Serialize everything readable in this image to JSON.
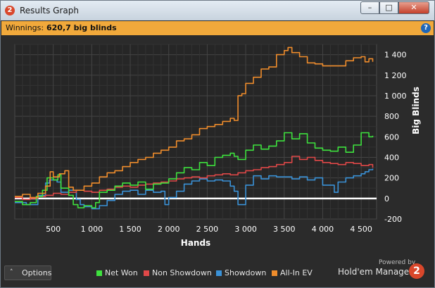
{
  "window": {
    "title": "Results Graph",
    "app_icon_text": "2",
    "buttons": {
      "minimize": "–",
      "maximize": "□",
      "close": "✕"
    }
  },
  "winnings": {
    "label": "Winnings:",
    "value": "620,7 big blinds",
    "help_icon": "?"
  },
  "options": {
    "chevron_icon": "˄",
    "label": "Options"
  },
  "branding": {
    "powered_by": "Powered by",
    "name": "Hold'em Manager",
    "logo_text": "2"
  },
  "colors": {
    "net_won": "#3ee23e",
    "non_showdown": "#e04848",
    "showdown": "#3a92d8",
    "all_in_ev": "#f08d2c",
    "zero_line": "#ffffff",
    "plot_bg": "#262626",
    "grid": "#3d3d3d",
    "winnings_bar": "#f1a93b"
  },
  "chart_data": {
    "type": "line",
    "xlabel": "Hands",
    "ylabel": "Big Blinds",
    "xlim": [
      0,
      4700
    ],
    "ylim": [
      -200,
      1500
    ],
    "xticks": [
      500,
      1000,
      1500,
      2000,
      2500,
      3000,
      3500,
      4000,
      4500
    ],
    "xtick_labels": [
      "500",
      "1 000",
      "1 500",
      "2 000",
      "2 500",
      "3 000",
      "3 500",
      "4 000",
      "4 500"
    ],
    "yticks": [
      -200,
      0,
      200,
      400,
      600,
      800,
      1000,
      1200,
      1400
    ],
    "ytick_labels": [
      "-200",
      "0",
      "200",
      "400",
      "600",
      "800",
      "1 000",
      "1 200",
      "1 400"
    ],
    "grid": true,
    "legend_position": "bottom",
    "series": [
      {
        "name": "Net Won",
        "x": [
          0,
          100,
          200,
          280,
          360,
          420,
          500,
          560,
          600,
          700,
          760,
          820,
          900,
          1000,
          1050,
          1100,
          1200,
          1300,
          1400,
          1500,
          1600,
          1700,
          1800,
          1900,
          2000,
          2100,
          2200,
          2300,
          2400,
          2500,
          2600,
          2700,
          2800,
          2850,
          2900,
          3000,
          3100,
          3200,
          3300,
          3400,
          3500,
          3600,
          3700,
          3800,
          3900,
          4000,
          4100,
          4200,
          4300,
          4400,
          4500,
          4600,
          4650
        ],
        "y": [
          -30,
          -60,
          -40,
          20,
          80,
          200,
          180,
          230,
          100,
          30,
          -60,
          -90,
          -70,
          -90,
          -40,
          60,
          80,
          120,
          150,
          130,
          160,
          90,
          140,
          150,
          190,
          250,
          300,
          280,
          350,
          320,
          400,
          420,
          440,
          410,
          380,
          470,
          520,
          480,
          510,
          560,
          640,
          580,
          630,
          540,
          490,
          470,
          460,
          500,
          450,
          520,
          640,
          600,
          610
        ]
      },
      {
        "name": "Non Showdown",
        "x": [
          0,
          100,
          200,
          300,
          400,
          500,
          600,
          700,
          800,
          900,
          1000,
          1100,
          1200,
          1300,
          1400,
          1500,
          1600,
          1700,
          1800,
          1900,
          2000,
          2100,
          2200,
          2300,
          2400,
          2500,
          2600,
          2700,
          2800,
          2900,
          3000,
          3100,
          3200,
          3300,
          3400,
          3500,
          3600,
          3700,
          3800,
          3900,
          4000,
          4100,
          4200,
          4300,
          4400,
          4500,
          4600,
          4650
        ],
        "y": [
          10,
          -10,
          0,
          20,
          30,
          50,
          40,
          60,
          80,
          70,
          60,
          80,
          90,
          110,
          120,
          110,
          130,
          140,
          150,
          160,
          170,
          190,
          200,
          210,
          200,
          220,
          230,
          240,
          230,
          250,
          270,
          280,
          300,
          310,
          330,
          350,
          410,
          380,
          400,
          370,
          350,
          340,
          330,
          350,
          340,
          320,
          330,
          300
        ]
      },
      {
        "name": "Showdown",
        "x": [
          0,
          150,
          300,
          400,
          450,
          550,
          600,
          700,
          800,
          850,
          900,
          1000,
          1100,
          1200,
          1300,
          1400,
          1500,
          1600,
          1700,
          1800,
          1900,
          1950,
          2000,
          2100,
          2200,
          2300,
          2400,
          2500,
          2600,
          2700,
          2800,
          2850,
          2900,
          3000,
          3100,
          3200,
          3300,
          3400,
          3500,
          3600,
          3700,
          3800,
          3900,
          4000,
          4100,
          4150,
          4200,
          4300,
          4400,
          4500,
          4550,
          4600,
          4650
        ],
        "y": [
          -40,
          -60,
          30,
          150,
          180,
          160,
          60,
          80,
          -10,
          -60,
          -80,
          -100,
          -70,
          -20,
          40,
          70,
          80,
          40,
          80,
          60,
          70,
          -60,
          10,
          70,
          140,
          170,
          190,
          170,
          180,
          170,
          120,
          70,
          -60,
          130,
          220,
          190,
          220,
          210,
          210,
          190,
          210,
          180,
          200,
          130,
          130,
          60,
          160,
          200,
          220,
          240,
          260,
          280,
          290
        ]
      },
      {
        "name": "All-In EV",
        "x": [
          0,
          100,
          200,
          300,
          400,
          460,
          500,
          580,
          650,
          700,
          760,
          900,
          1000,
          1100,
          1200,
          1300,
          1400,
          1500,
          1600,
          1700,
          1800,
          1900,
          2000,
          2100,
          2200,
          2300,
          2400,
          2500,
          2600,
          2700,
          2800,
          2850,
          2900,
          2950,
          3000,
          3100,
          3200,
          3300,
          3400,
          3500,
          3550,
          3600,
          3700,
          3800,
          3900,
          4000,
          4100,
          4200,
          4300,
          4400,
          4500,
          4550,
          4600,
          4650
        ],
        "y": [
          20,
          40,
          10,
          50,
          120,
          260,
          210,
          240,
          270,
          110,
          80,
          120,
          150,
          210,
          250,
          270,
          310,
          350,
          380,
          400,
          440,
          470,
          500,
          560,
          580,
          620,
          680,
          700,
          720,
          750,
          780,
          760,
          1000,
          1020,
          1120,
          1180,
          1260,
          1280,
          1400,
          1440,
          1470,
          1420,
          1380,
          1320,
          1310,
          1290,
          1290,
          1290,
          1340,
          1370,
          1380,
          1330,
          1360,
          1330
        ]
      }
    ]
  }
}
